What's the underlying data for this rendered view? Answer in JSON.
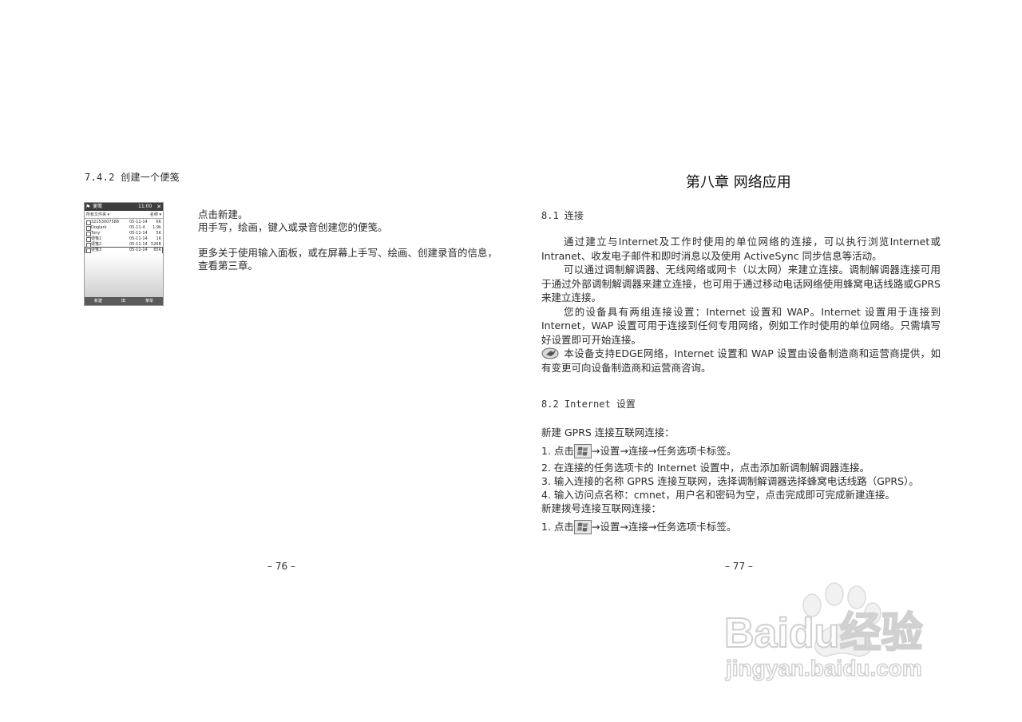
{
  "left_page": {
    "heading": "7.4.2 创建一个便笺",
    "paragraph_1": "点击新建。",
    "paragraph_2": "用手写，绘画，键入或录音创建您的便笺。",
    "paragraph_3_line_1": "更多关于使用输入面板，或在屏幕上手写、绘画、创建录音的信息，",
    "paragraph_3_line_2": "查看第三章。",
    "page_number": "– 76 –"
  },
  "device_screenshot": {
    "title": "便笺",
    "clock": "11:00",
    "filter_label": "所有文件夹 ▾",
    "sort_label": "名称 ▾",
    "rows": [
      {
        "name": "32153007588",
        "date": "05-11-14",
        "size": "6K"
      },
      {
        "name": "Doglark",
        "date": "05-11-4",
        "size": "1.9k"
      },
      {
        "name": "Tony",
        "date": "05-11-14",
        "size": "5K"
      },
      {
        "name": "便笺1",
        "date": "05-11-14",
        "size": "1K"
      },
      {
        "name": "便笺2",
        "date": "05-11-14",
        "size": "526B"
      },
      {
        "name": "便笺3",
        "date": "05-11-14",
        "size": "65K"
      }
    ],
    "menu_left": "新建",
    "menu_mid": "田",
    "menu_right": "菜单"
  },
  "right_page": {
    "chapter_title": "第八章  网络应用",
    "section_81": "8.1 连接",
    "p1": "通过建立与Internet及工作时使用的单位网络的连接，可以执行浏览Internet或Intranet、收发电子邮件和即时消息以及使用 ActiveSync 同步信息等活动。",
    "p2": "可以通过调制解调器、无线网络或网卡（以太网）来建立连接。调制解调器连接可用于通过外部调制解调器来建立连接，也可用于通过移动电话网络使用蜂窝电话线路或GPRS来建立连接。",
    "p3": "您的设备具有两组连接设置：Internet 设置和 WAP。Internet 设置用于连接到 Internet，WAP 设置可用于连接到任何专用网络，例如工作时使用的单位网络。只需填写好设置即可开始连接。",
    "note": "本设备支持EDGE网络，Internet 设置和 WAP 设置由设备制造商和运营商提供，如有变更可向设备制造商和运营商咨询。",
    "section_82": "8.2 Internet 设置",
    "gprs_intro": "新建 GPRS 连接互联网连接：",
    "step1_prefix": "1. 点击",
    "step1_suffix": "→设置→连接→任务选项卡标签。",
    "step2": "2. 在连接的任务选项卡的 Internet 设置中，点击添加新调制解调器连接。",
    "step3": "3. 输入连接的名称 GPRS 连接互联网，选择调制解调器选择蜂窝电话线路（GPRS）。",
    "step4": "4. 输入访问点名称：cmnet，用户名和密码为空，点击完成即可完成新建连接。",
    "dial_intro": "新建拨号连接互联网连接：",
    "dial_step1_prefix": "1. 点击",
    "dial_step1_suffix": "→设置→连接→任务选项卡标签。",
    "page_number": "– 77 –"
  },
  "icons": {
    "start_menu": "windows-logo-icon",
    "note": "note-pointer-icon"
  },
  "watermark": {
    "brand": "Baidu经验",
    "url": "jingyan.baidu.com"
  }
}
